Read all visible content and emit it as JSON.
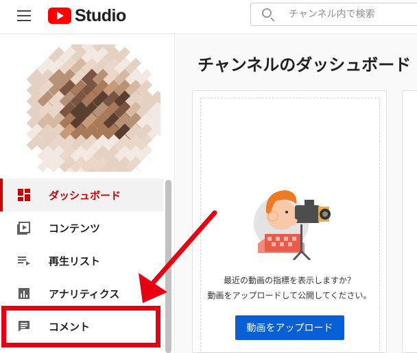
{
  "header": {
    "logo_text": "Studio",
    "search": {
      "placeholder": "チャンネル内で検索",
      "value": ""
    }
  },
  "sidebar": {
    "items": [
      {
        "label": "ダッシュボード",
        "icon": "dashboard-icon",
        "active": true
      },
      {
        "label": "コンテンツ",
        "icon": "video-content-icon",
        "active": false
      },
      {
        "label": "再生リスト",
        "icon": "playlist-icon",
        "active": false
      },
      {
        "label": "アナリティクス",
        "icon": "analytics-icon",
        "active": false
      },
      {
        "label": "コメント",
        "icon": "comment-icon",
        "active": false
      }
    ]
  },
  "main": {
    "title": "チャンネルのダッシュボード",
    "upload_card": {
      "prompt_line1": "最近の動画の指標を表示しますか？",
      "prompt_line2": "動画をアップロードして公開してください。",
      "button_label": "動画をアップロード"
    }
  },
  "colors": {
    "accent_red": "#cc0000",
    "primary_blue": "#065fd4",
    "youtube_red": "#ff0000",
    "annotation_red": "#e60012"
  }
}
